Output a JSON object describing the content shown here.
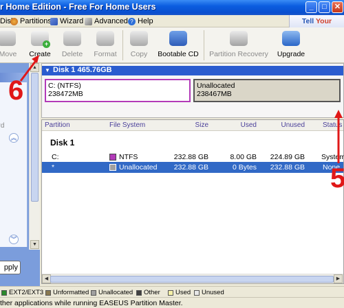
{
  "window": {
    "title": "r Home Edition - Free For Home Users",
    "controls": {
      "minimize": "_",
      "maximize": "□",
      "close": "✕"
    }
  },
  "menu": {
    "items": [
      {
        "label": "Disk",
        "icon": "disk-icon"
      },
      {
        "label": "Partitions",
        "icon": "partitions-icon"
      },
      {
        "label": "Wizard",
        "icon": "wizard-icon"
      },
      {
        "label": "Advanced",
        "icon": "advanced-icon"
      },
      {
        "label": "Help",
        "icon": "help-icon"
      }
    ],
    "tell_friends_a": "Tell ",
    "tell_friends_b": "Your Friends"
  },
  "toolbar": {
    "items": [
      {
        "label": "/Move",
        "enabled": false,
        "icon": "resize-move-icon"
      },
      {
        "label": "Create",
        "enabled": true,
        "icon": "create-partition-icon"
      },
      {
        "label": "Delete",
        "enabled": false,
        "icon": "delete-partition-icon"
      },
      {
        "label": "Format",
        "enabled": false,
        "icon": "format-partition-icon"
      },
      {
        "label": "Copy",
        "enabled": false,
        "icon": "copy-partition-icon"
      },
      {
        "label": "Bootable CD",
        "enabled": true,
        "icon": "bootable-cd-icon"
      },
      {
        "label": "Partition Recovery",
        "enabled": false,
        "icon": "partition-recovery-icon"
      },
      {
        "label": "Upgrade",
        "enabled": true,
        "icon": "upgrade-icon"
      }
    ]
  },
  "left_panel": {
    "partial_item": "ard",
    "apply_label": "pply"
  },
  "disk_map": {
    "header": "Disk 1  465.76GB",
    "partitions": [
      {
        "line1": "C: (NTFS)",
        "line2": "238472MB"
      },
      {
        "line1": "Unallocated",
        "line2": "238467MB"
      }
    ]
  },
  "table": {
    "headers": [
      "Partition",
      "File System",
      "Size",
      "Used",
      "Unused",
      "Status"
    ],
    "group_label": "Disk 1",
    "rows": [
      {
        "partition": "C:",
        "fs": "NTFS",
        "size": "232.88 GB",
        "used": "8.00 GB",
        "unused": "224.89 GB",
        "status": "System",
        "selected": false
      },
      {
        "partition": "*",
        "fs": "Unallocated",
        "size": "232.88 GB",
        "used": "0 Bytes",
        "unused": "232.88 GB",
        "status": "None",
        "selected": true
      }
    ]
  },
  "legend": {
    "items": [
      {
        "label": "EXT2/EXT3",
        "color": "#2c8a2c"
      },
      {
        "label": "Unformatted",
        "color": "#8a7a50"
      },
      {
        "label": "Unallocated",
        "color": "#a0a0a0"
      },
      {
        "label": "Other",
        "color": "#404040"
      },
      {
        "label": "Used",
        "color": "#f5f0a8"
      },
      {
        "label": "Unused",
        "color": "#e8e8e8"
      }
    ]
  },
  "status_bar": "ther applications while running EASEUS Partition Master.",
  "annotations": {
    "six": "6",
    "five": "5"
  },
  "colors": {
    "title_blue": "#0b5de0",
    "selection": "#3169c6",
    "ntfs": "#b23ab8",
    "annotation_red": "#e01818"
  }
}
